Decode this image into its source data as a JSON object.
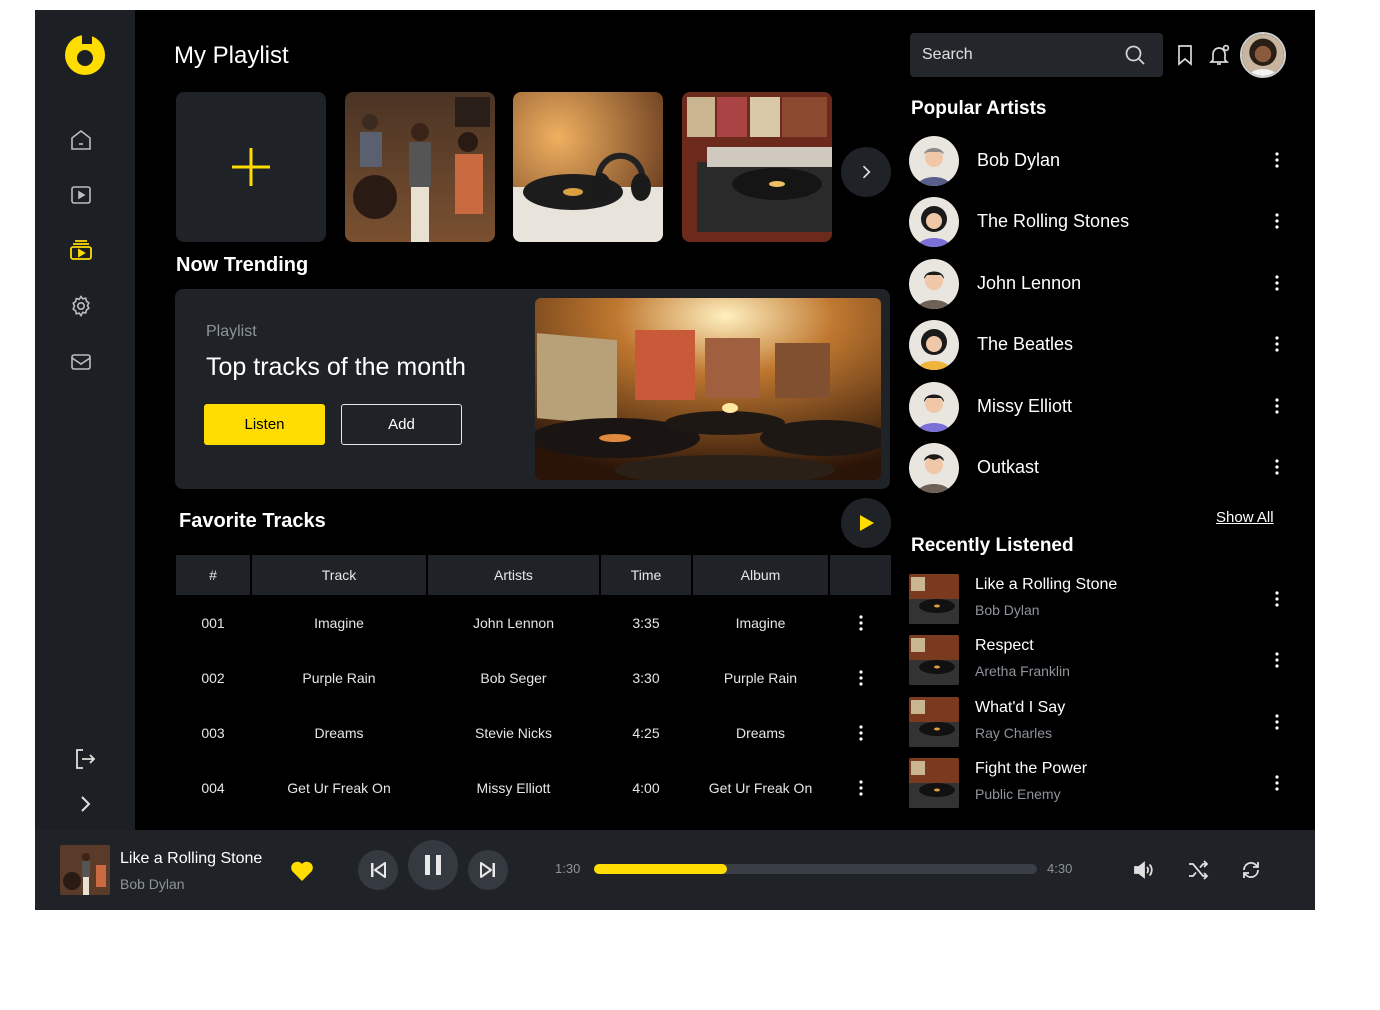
{
  "colors": {
    "accent": "#ffdd00",
    "background": "#000000",
    "panel": "#1f2226",
    "sidebar": "#1c1f23",
    "muted": "#8e949a"
  },
  "header": {
    "title": "My Playlist",
    "search_placeholder": "Search"
  },
  "sidebar": {
    "items": [
      {
        "icon": "home-icon"
      },
      {
        "icon": "video-play-icon"
      },
      {
        "icon": "playlist-icon",
        "active": true
      },
      {
        "icon": "settings-gear-icon"
      },
      {
        "icon": "mail-icon"
      }
    ],
    "bottom": [
      {
        "icon": "logout-icon"
      },
      {
        "icon": "chevron-right-icon"
      }
    ]
  },
  "trending": {
    "section_title": "Now Trending",
    "kicker": "Playlist",
    "title": "Top tracks of the month",
    "listen_label": "Listen",
    "add_label": "Add"
  },
  "favorites": {
    "section_title": "Favorite Tracks",
    "columns": [
      "#",
      "Track",
      "Artists",
      "Time",
      "Album"
    ],
    "rows": [
      {
        "num": "001",
        "track": "Imagine",
        "artist": "John Lennon",
        "time": "3:35",
        "album": "Imagine"
      },
      {
        "num": "002",
        "track": "Purple Rain",
        "artist": "Bob Seger",
        "time": "3:30",
        "album": "Purple Rain"
      },
      {
        "num": "003",
        "track": "Dreams",
        "artist": "Stevie Nicks",
        "time": "4:25",
        "album": "Dreams"
      },
      {
        "num": "004",
        "track": "Get Ur Freak On",
        "artist": "Missy Elliott",
        "time": "4:00",
        "album": "Get Ur Freak On"
      }
    ]
  },
  "popular": {
    "section_title": "Popular Artists",
    "artists": [
      {
        "name": "Bob Dylan"
      },
      {
        "name": "The Rolling Stones"
      },
      {
        "name": "John Lennon"
      },
      {
        "name": "The Beatles"
      },
      {
        "name": "Missy Elliott"
      },
      {
        "name": "Outkast"
      }
    ],
    "show_all": "Show All"
  },
  "recent": {
    "section_title": "Recently Listened",
    "items": [
      {
        "title": "Like a Rolling Stone",
        "artist": "Bob Dylan"
      },
      {
        "title": "Respect",
        "artist": "Aretha Franklin"
      },
      {
        "title": "What'd I Say",
        "artist": "Ray Charles"
      },
      {
        "title": "Fight the Power",
        "artist": "Public Enemy"
      }
    ]
  },
  "player": {
    "title": "Like a Rolling Stone",
    "artist": "Bob Dylan",
    "elapsed": "1:30",
    "total": "4:30",
    "progress_fraction": 0.3,
    "liked": true
  }
}
